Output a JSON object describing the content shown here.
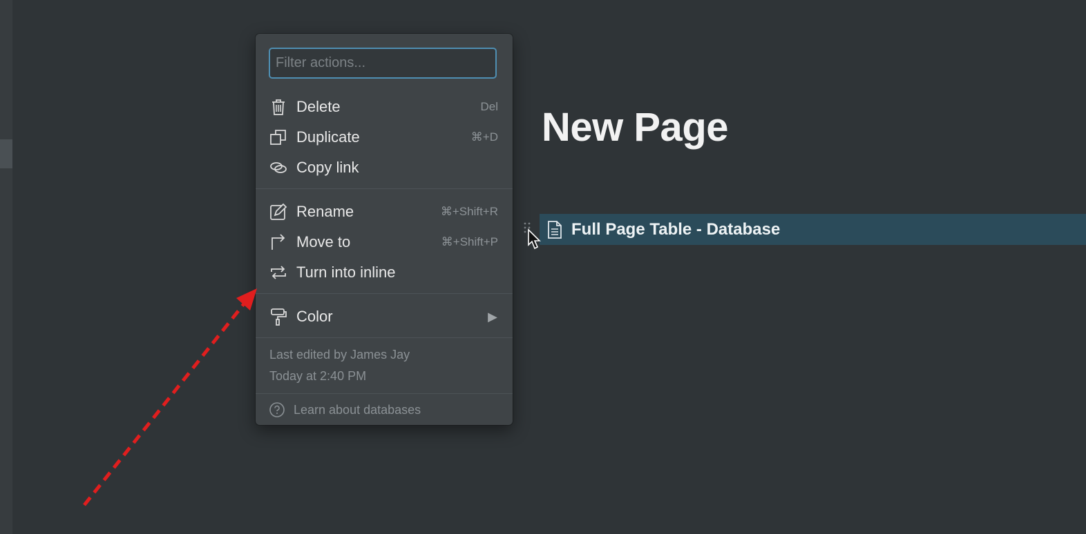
{
  "page": {
    "title": "New Page"
  },
  "database_row": {
    "title": "Full Page Table - Database",
    "icon": "page-document-icon"
  },
  "menu": {
    "filter": {
      "placeholder": "Filter actions...",
      "value": ""
    },
    "groups": [
      [
        {
          "label": "Delete",
          "shortcut": "Del",
          "icon": "trash-icon"
        },
        {
          "label": "Duplicate",
          "shortcut": "⌘+D",
          "icon": "duplicate-icon"
        },
        {
          "label": "Copy link",
          "shortcut": "",
          "icon": "link-icon"
        }
      ],
      [
        {
          "label": "Rename",
          "shortcut": "⌘+Shift+R",
          "icon": "edit-icon"
        },
        {
          "label": "Move to",
          "shortcut": "⌘+Shift+P",
          "icon": "move-arrow-icon"
        },
        {
          "label": "Turn into inline",
          "shortcut": "",
          "icon": "swap-icon"
        }
      ],
      [
        {
          "label": "Color",
          "arrow": "▶",
          "icon": "paint-roller-icon"
        }
      ]
    ],
    "last_edited_by": "Last edited by James Jay",
    "last_edited_time": "Today at 2:40 PM",
    "learn_link": "Learn about databases"
  },
  "colors": {
    "background": "#2f3437",
    "menu_background": "#3f4447",
    "selection": "#2b4b5a",
    "focus_ring": "#4f8fb3",
    "annotation_arrow": "#e01e1e"
  }
}
